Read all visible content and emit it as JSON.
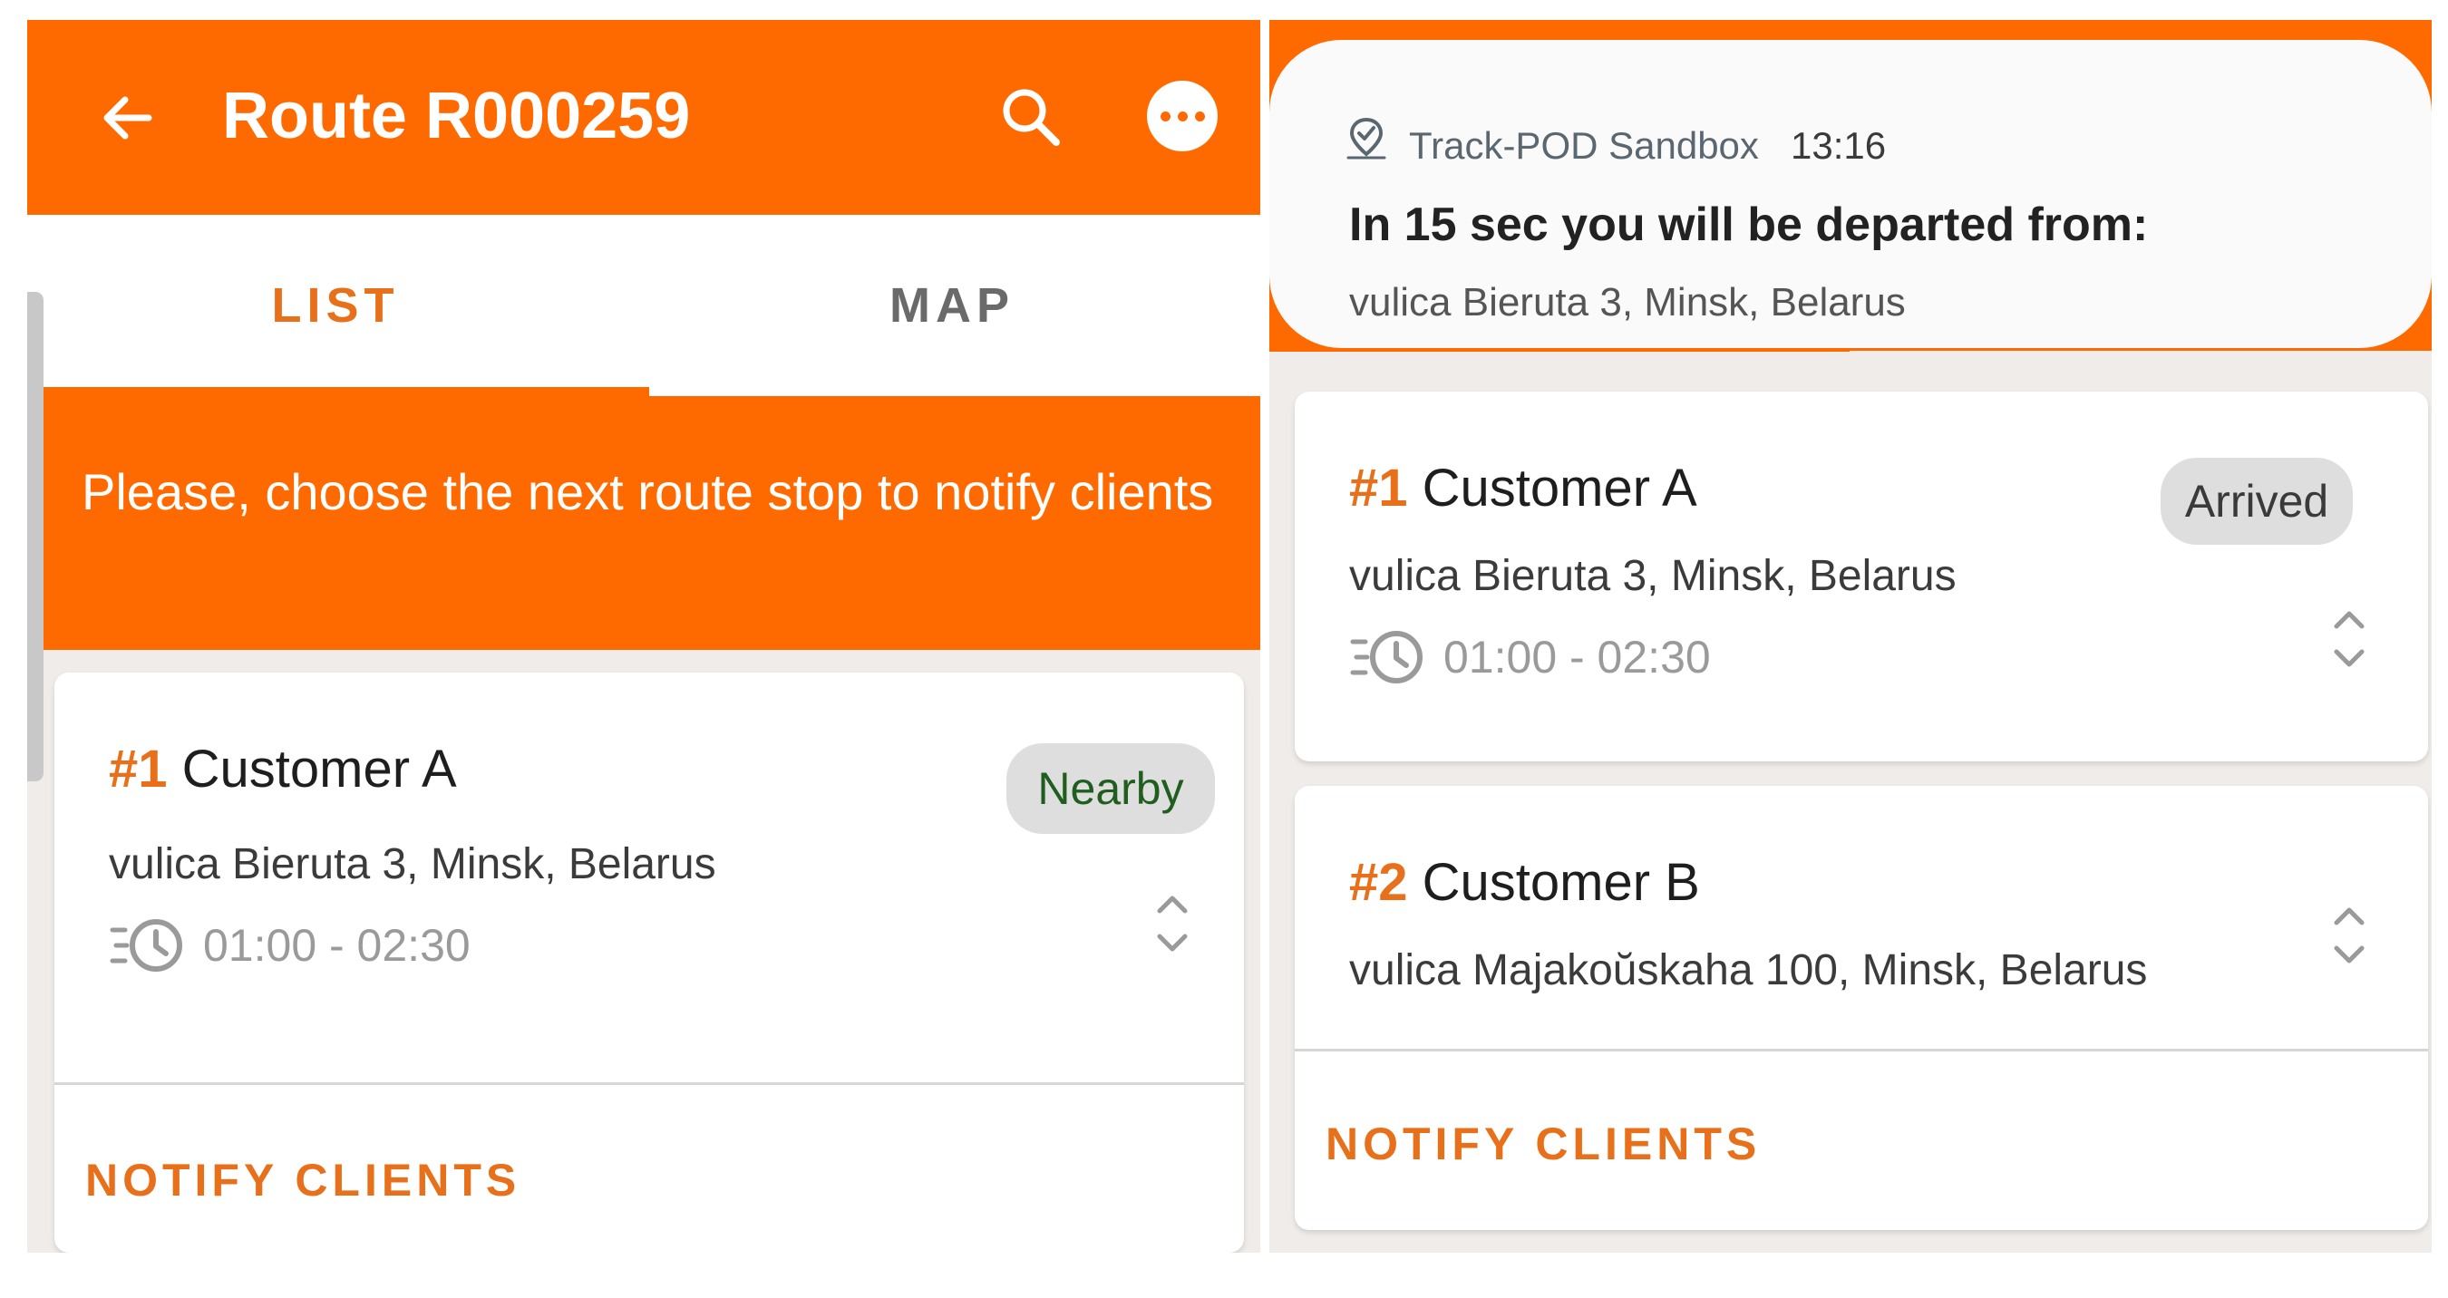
{
  "left": {
    "header": {
      "title": "Route R000259",
      "back_icon": "back-arrow-icon",
      "search_icon": "search-icon",
      "more_icon": "more-options-icon"
    },
    "tabs": [
      {
        "label": "LIST",
        "active": true
      },
      {
        "label": "MAP",
        "active": false
      }
    ],
    "banner": {
      "text": "Please, choose the next route stop to notify clients"
    },
    "stop": {
      "number": "#1",
      "name": "Customer A",
      "address": "vulica Bieruta 3, Minsk, Belarus",
      "time_window": "01:00 - 02:30",
      "status": "Nearby",
      "status_color": "#1f5e1f"
    },
    "action": "NOTIFY CLIENTS"
  },
  "right": {
    "notification": {
      "app_name": "Track-POD Sandbox",
      "time": "13:16",
      "title": "In 15 sec you will be departed from:",
      "body": "vulica Bieruta 3, Minsk, Belarus"
    },
    "stops": [
      {
        "number": "#1",
        "name": "Customer A",
        "address": "vulica Bieruta 3, Minsk, Belarus",
        "time_window": "01:00 - 02:30",
        "status": "Arrived"
      },
      {
        "number": "#2",
        "name": "Customer B",
        "address": "vulica Majakoŭskaha 100, Minsk, Belarus"
      }
    ],
    "action": "NOTIFY CLIENTS"
  },
  "colors": {
    "brand_orange": "#ff6a00",
    "accent_text_orange": "#e8701a",
    "background": "#efecea",
    "card": "#ffffff",
    "badge_gray": "#dedede"
  }
}
